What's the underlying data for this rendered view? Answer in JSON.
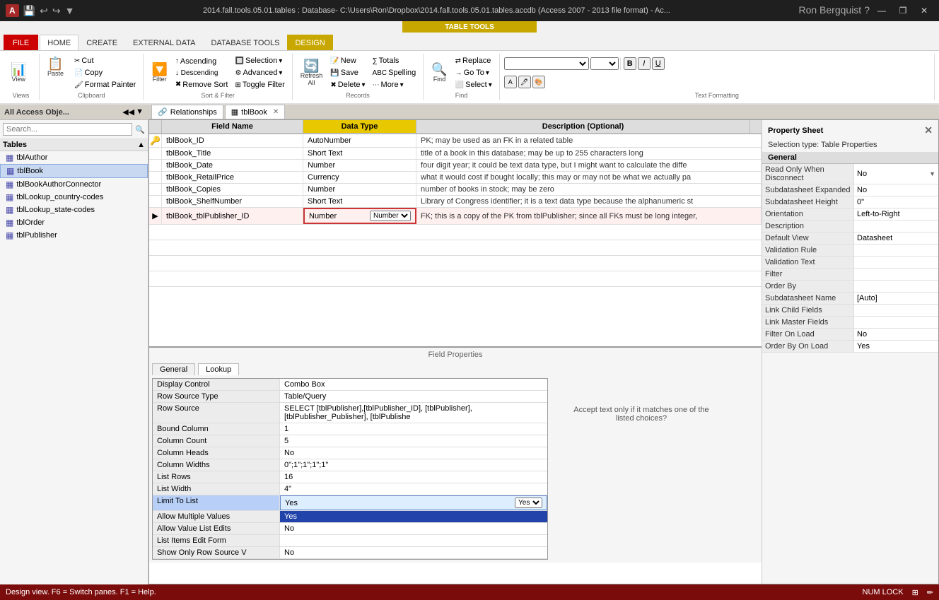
{
  "titlebar": {
    "app_label": "A",
    "title": "2014.fall.tools.05.01.tables : Database- C:\\Users\\Ron\\Dropbox\\2014.fall.tools.05.01.tables.accdb (Access 2007 - 2013 file format) - Ac...",
    "help": "?",
    "minimize": "—",
    "restore": "❐",
    "close": "✕"
  },
  "ribbon": {
    "contextual_label": "TABLE TOOLS",
    "tabs": [
      "FILE",
      "HOME",
      "CREATE",
      "EXTERNAL DATA",
      "DATABASE TOOLS",
      "DESIGN"
    ],
    "active_tab": "HOME",
    "groups": {
      "views": {
        "label": "Views",
        "btn": "View"
      },
      "clipboard": {
        "label": "Clipboard",
        "paste": "Paste",
        "cut": "Cut",
        "copy": "Copy",
        "format_painter": "Format Painter"
      },
      "sort_filter": {
        "label": "Sort & Filter",
        "ascending": "Ascending",
        "descending": "Descending",
        "remove_sort": "Remove Sort",
        "selection": "Selection",
        "advanced": "Advanced",
        "toggle": "Toggle Filter",
        "filter": "Filter"
      },
      "records": {
        "label": "Records",
        "new": "New",
        "save": "Save",
        "delete": "Delete",
        "totals": "Totals",
        "spelling": "Spelling",
        "more": "More"
      },
      "find": {
        "label": "Find",
        "find": "Find",
        "replace": "Replace",
        "go_to": "Go To",
        "select": "Select"
      },
      "text_formatting": {
        "label": "Text Formatting"
      },
      "refresh": {
        "label": "Refresh All"
      }
    }
  },
  "nav": {
    "title": "All Access Obje...",
    "search_placeholder": "Search...",
    "section": "Tables",
    "items": [
      {
        "label": "tblAuthor"
      },
      {
        "label": "tblBook",
        "selected": true
      },
      {
        "label": "tblBookAuthorConnector"
      },
      {
        "label": "tblLookup_country-codes"
      },
      {
        "label": "tblLookup_state-codes"
      },
      {
        "label": "tblOrder"
      },
      {
        "label": "tblPublisher"
      }
    ]
  },
  "tabs": [
    {
      "label": "Relationships",
      "icon": "🔗"
    },
    {
      "label": "tblBook",
      "icon": "📋",
      "active": true
    }
  ],
  "table": {
    "headers": [
      "Field Name",
      "Data Type",
      "Description (Optional)"
    ],
    "rows": [
      {
        "key": true,
        "marker": "▶",
        "fieldname": "tblBook_ID",
        "datatype": "AutoNumber",
        "description": "PK; may be used as an FK in a related table"
      },
      {
        "fieldname": "tblBook_Title",
        "datatype": "Short Text",
        "description": "title of a book in this database; may be up to 255  characters long"
      },
      {
        "fieldname": "tblBook_Date",
        "datatype": "Number",
        "description": "four digit year; it could be text data type, but I might want to calculate the diffe"
      },
      {
        "fieldname": "tblBook_RetailPrice",
        "datatype": "Currency",
        "description": "what it would cost if bought locally; this may or may not be what we actually pa"
      },
      {
        "fieldname": "tblBook_Copies",
        "datatype": "Number",
        "description": "number of books in stock; may be zero"
      },
      {
        "fieldname": "tblBook_ShelfNumber",
        "datatype": "Short Text",
        "description": "Library of Congress identifier; it is a text data type because the alphanumeric st"
      },
      {
        "fieldname": "tblBook_tblPublisher_ID",
        "datatype": "Number",
        "description": "FK; this is a copy of the PK from tblPublisher; since all FKs must be long integer,",
        "selected": true,
        "has_dropdown": true
      }
    ]
  },
  "field_properties": {
    "title": "Field Properties",
    "tabs": [
      "General",
      "Lookup"
    ],
    "active_tab": "Lookup",
    "rows": [
      {
        "label": "Display Control",
        "value": "Combo Box"
      },
      {
        "label": "Row Source Type",
        "value": "Table/Query"
      },
      {
        "label": "Row Source",
        "value": "SELECT [tblPublisher],[tblPublisher_ID], [tblPublisher],[tblPublisher_Publisher], [tblPublishe"
      },
      {
        "label": "Bound Column",
        "value": "1"
      },
      {
        "label": "Column Count",
        "value": "5"
      },
      {
        "label": "Column Heads",
        "value": "No"
      },
      {
        "label": "Column Widths",
        "value": "0\";1\";1\";1\";1\""
      },
      {
        "label": "List Rows",
        "value": "16"
      },
      {
        "label": "List Width",
        "value": "4\""
      },
      {
        "label": "Limit To List",
        "value": "Yes",
        "active": true
      },
      {
        "label": "Allow Multiple Values",
        "value": "Yes",
        "highlight": true
      },
      {
        "label": "Allow Value List Edits",
        "value": "No"
      },
      {
        "label": "List Items Edit Form",
        "value": ""
      },
      {
        "label": "Show Only Row Source V",
        "value": "No"
      }
    ],
    "hint": "Accept text only if it matches one of the listed choices?"
  },
  "property_sheet": {
    "title": "Property Sheet",
    "selection_type": "Selection type: Table Properties",
    "tab": "General",
    "rows": [
      {
        "label": "Read Only When Disconnect",
        "value": "No",
        "has_dropdown": true
      },
      {
        "label": "Subdatasheet Expanded",
        "value": "No"
      },
      {
        "label": "Subdatasheet Height",
        "value": "0\""
      },
      {
        "label": "Orientation",
        "value": "Left-to-Right"
      },
      {
        "label": "Description",
        "value": ""
      },
      {
        "label": "Default View",
        "value": "Datasheet"
      },
      {
        "label": "Validation Rule",
        "value": ""
      },
      {
        "label": "Validation Text",
        "value": ""
      },
      {
        "label": "Filter",
        "value": ""
      },
      {
        "label": "Order By",
        "value": ""
      },
      {
        "label": "Subdatasheet Name",
        "value": "[Auto]"
      },
      {
        "label": "Link Child Fields",
        "value": ""
      },
      {
        "label": "Link Master Fields",
        "value": ""
      },
      {
        "label": "Filter On Load",
        "value": "No"
      },
      {
        "label": "Order By On Load",
        "value": "Yes"
      }
    ]
  },
  "statusbar": {
    "text": "Design view.  F6 = Switch panes.  F1 = Help.",
    "num_lock": "NUM LOCK"
  },
  "user": "Ron Bergquist"
}
